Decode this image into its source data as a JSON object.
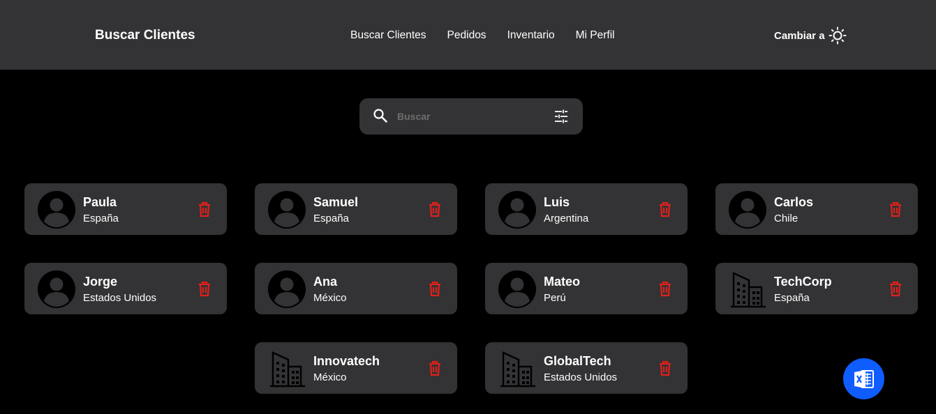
{
  "header": {
    "title": "Buscar Clientes",
    "nav": [
      "Buscar Clientes",
      "Pedidos",
      "Inventario",
      "Mi Perfil"
    ],
    "theme_toggle_label": "Cambiar a",
    "theme_icon": "sun-icon"
  },
  "search": {
    "placeholder": "Buscar",
    "value": "",
    "search_icon": "search-icon",
    "filter_icon": "filter-sliders-icon"
  },
  "clients": [
    {
      "name": "Paula",
      "country": "España",
      "type": "person"
    },
    {
      "name": "Samuel",
      "country": "España",
      "type": "person"
    },
    {
      "name": "Luis",
      "country": "Argentina",
      "type": "person"
    },
    {
      "name": "Carlos",
      "country": "Chile",
      "type": "person"
    },
    {
      "name": "Jorge",
      "country": "Estados Unidos",
      "type": "person"
    },
    {
      "name": "Ana",
      "country": "México",
      "type": "person"
    },
    {
      "name": "Mateo",
      "country": "Perú",
      "type": "person"
    },
    {
      "name": "TechCorp",
      "country": "España",
      "type": "company"
    },
    {
      "name": "Innovatech",
      "country": "México",
      "type": "company"
    },
    {
      "name": "GlobalTech",
      "country": "Estados Unidos",
      "type": "company"
    }
  ],
  "export_button": {
    "icon": "excel-icon"
  },
  "colors": {
    "background": "#000000",
    "surface": "#333234",
    "delete": "#e0201b",
    "excel_fab": "#0f5cff"
  }
}
